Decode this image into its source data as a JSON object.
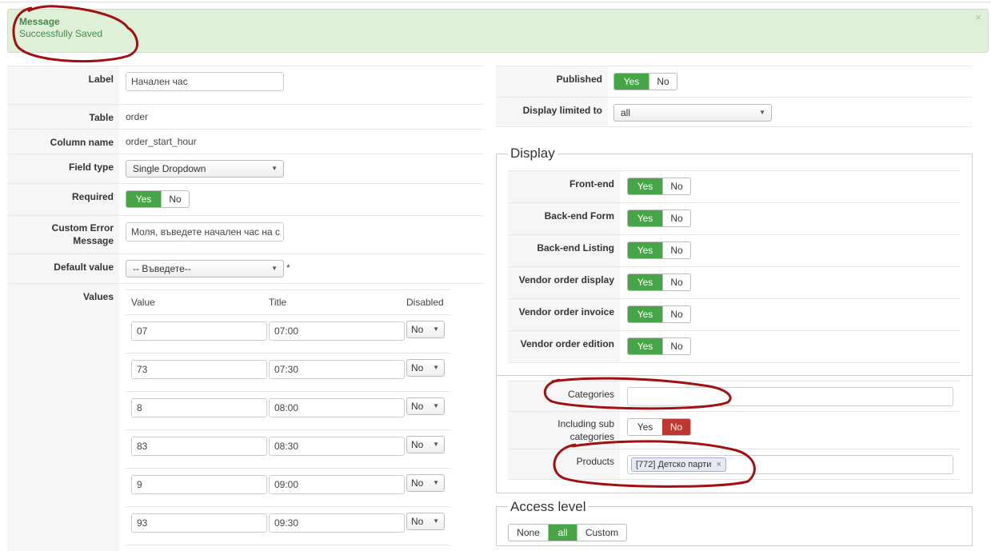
{
  "message": {
    "heading": "Message",
    "body": "Successfully Saved",
    "close": "×"
  },
  "left": {
    "label": {
      "label": "Label",
      "value": "Начален час"
    },
    "table": {
      "label": "Table",
      "value": "order"
    },
    "column": {
      "label": "Column name",
      "value": "order_start_hour"
    },
    "field_type": {
      "label": "Field type",
      "value": "Single Dropdown"
    },
    "required": {
      "label": "Required",
      "yes": "Yes",
      "no": "No",
      "selected": "yes"
    },
    "custom_error": {
      "label_line1": "Custom Error",
      "label_line2": "Message",
      "value": "Моля, въведете начален час на с"
    },
    "default_value": {
      "label": "Default value",
      "value": "-- Въведете--",
      "required_mark": "*"
    },
    "values": {
      "label": "Values",
      "headers": {
        "value": "Value",
        "title": "Title",
        "disabled": "Disabled"
      },
      "rows": [
        {
          "value": "07",
          "title": "07:00",
          "disabled": "No"
        },
        {
          "value": "73",
          "title": "07:30",
          "disabled": "No"
        },
        {
          "value": "8",
          "title": "08:00",
          "disabled": "No"
        },
        {
          "value": "83",
          "title": "08:30",
          "disabled": "No"
        },
        {
          "value": "9",
          "title": "09:00",
          "disabled": "No"
        },
        {
          "value": "93",
          "title": "09:30",
          "disabled": "No"
        }
      ]
    }
  },
  "right": {
    "published": {
      "label": "Published",
      "yes": "Yes",
      "no": "No",
      "selected": "yes"
    },
    "display_limited": {
      "label": "Display limited to",
      "value": "all"
    },
    "display": {
      "legend": "Display",
      "items": [
        {
          "label": "Front-end",
          "yes": "Yes",
          "no": "No"
        },
        {
          "label": "Back-end Form",
          "yes": "Yes",
          "no": "No"
        },
        {
          "label": "Back-end Listing",
          "yes": "Yes",
          "no": "No"
        },
        {
          "label": "Vendor order display",
          "yes": "Yes",
          "no": "No"
        },
        {
          "label": "Vendor order invoice",
          "yes": "Yes",
          "no": "No"
        },
        {
          "label": "Vendor order edition",
          "yes": "Yes",
          "no": "No"
        }
      ]
    },
    "categories": {
      "label": "Categories",
      "value": ""
    },
    "including_sub": {
      "label_line1": "Including sub",
      "label_line2": "categories",
      "yes": "Yes",
      "no": "No",
      "selected": "no"
    },
    "products": {
      "label": "Products",
      "tag": "[772] Детско парти",
      "tag_remove": "×"
    },
    "access": {
      "legend": "Access level",
      "none": "None",
      "all": "all",
      "custom": "Custom",
      "selected": "all"
    }
  },
  "colors": {
    "success_bg": "#dff0d8",
    "success_text": "#468847",
    "yes_green": "#46a546",
    "no_red": "#bd362f",
    "annotation_red": "#a01010"
  },
  "icons": {
    "dropdown": "triangle-down",
    "close": "x-mark"
  }
}
